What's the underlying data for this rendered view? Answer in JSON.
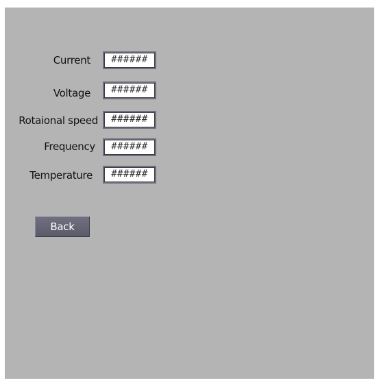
{
  "fields": [
    {
      "label": "Current",
      "value": "######"
    },
    {
      "label": "Voltage",
      "value": "######"
    },
    {
      "label": "Rotaional speed",
      "value": "######"
    },
    {
      "label": "Frequency",
      "value": "######"
    },
    {
      "label": "Temperature",
      "value": "######"
    }
  ],
  "buttons": {
    "back_label": "Back"
  }
}
